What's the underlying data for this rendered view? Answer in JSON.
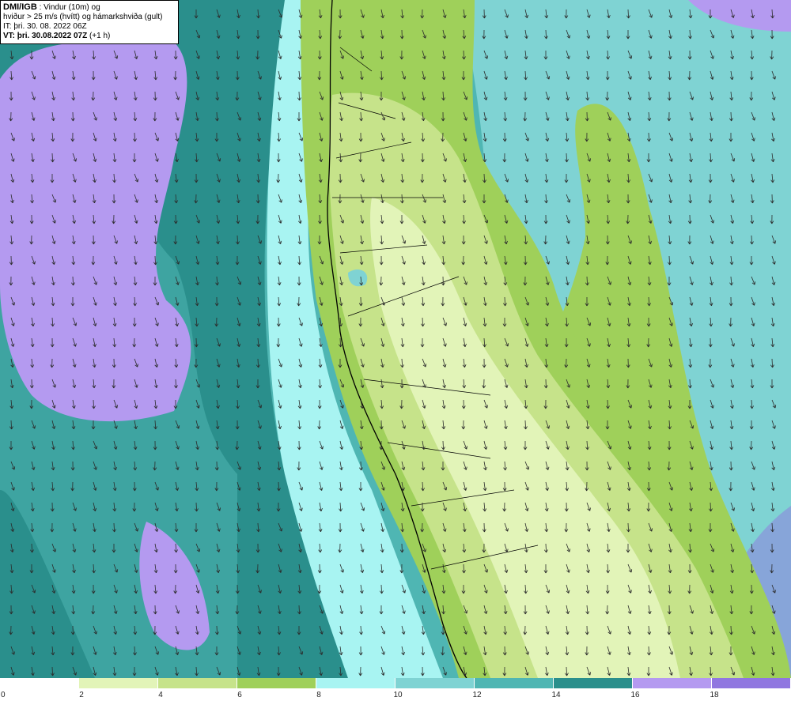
{
  "header": {
    "product": "DMI/IGB",
    "description_1": ": Vindur (10m) og",
    "description_2": "hviður > 25 m/s (hvítt) og hámarkshviða (gult)",
    "issue_time": "IT: þri. 30. 08. 2022 06Z",
    "valid_time_label": "VT: þri. 30.08.2022 07Z",
    "lead_time": "(+1 h)"
  },
  "legend": {
    "unit": "m/s",
    "ticks": [
      "0",
      "2",
      "4",
      "6",
      "8",
      "10",
      "12",
      "14",
      "16",
      "18"
    ],
    "colors": [
      "#ffffff",
      "#e2f4b8",
      "#c6e38a",
      "#9fd05a",
      "#a8f4f2",
      "#7fd3d3",
      "#4fb6b3",
      "#2a8f8c",
      "#b49af0",
      "#9077e0"
    ]
  },
  "map": {
    "features": [
      "wind-arrows",
      "coastline",
      "wind-speed-shading"
    ],
    "wind_direction": "from north-northeast",
    "colors": {
      "ocean_calm": "#b49af0",
      "ocean_strong": "#2a8f8c",
      "ocean_mid": "#4fb6b3",
      "ocean_light": "#7fd3d3",
      "ocean_lighter": "#a8f4f2",
      "land_high": "#9fd05a",
      "land_mid": "#c6e38a",
      "land_low": "#e2f4b8",
      "coastline": "#000000",
      "arrow": "#2b2b2b"
    }
  }
}
